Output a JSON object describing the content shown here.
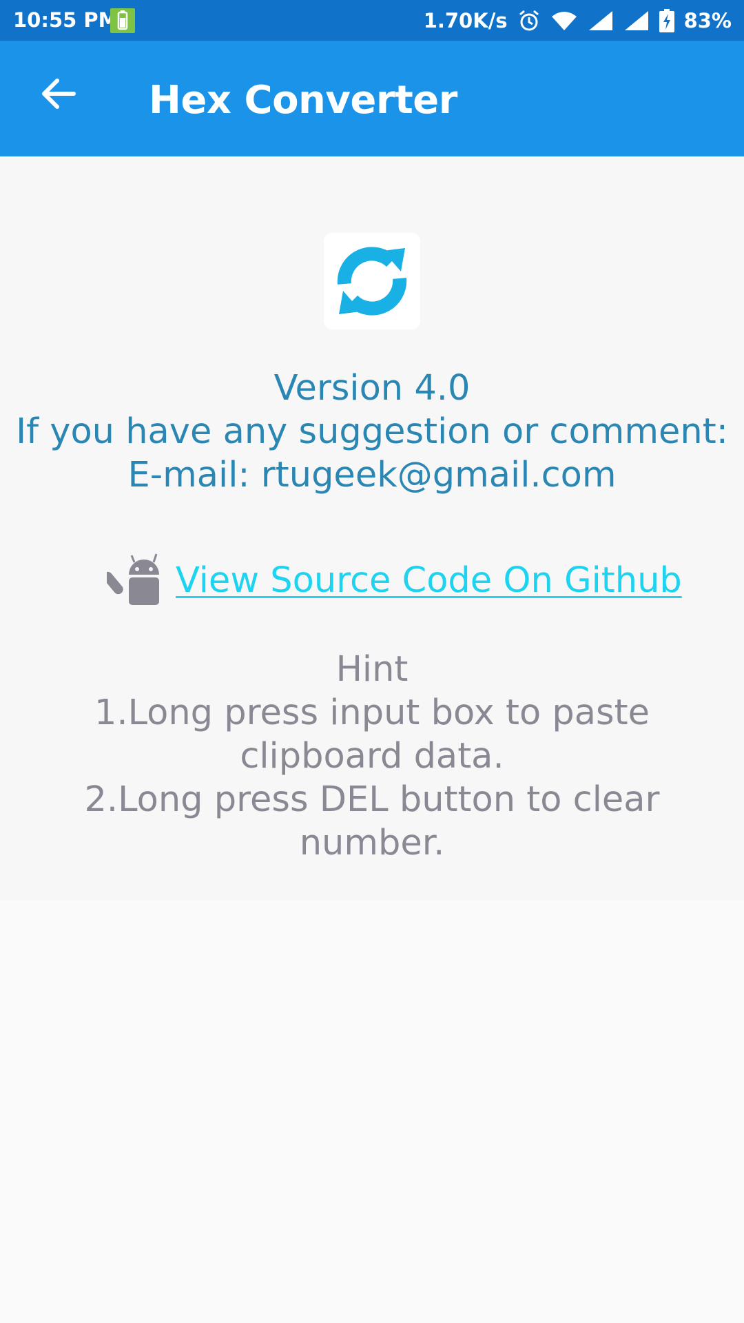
{
  "status_bar": {
    "time": "10:55 PM",
    "network_speed": "1.70K/s",
    "battery": "83%",
    "icons": [
      "battery-saver-icon",
      "alarm-icon",
      "wifi-icon",
      "signal-icon",
      "signal-icon",
      "battery-charging-icon"
    ]
  },
  "app_bar": {
    "title": "Hex Converter",
    "back_icon": "arrow-left-icon",
    "color": "#1a93e8"
  },
  "about": {
    "app_icon": "refresh-arrows-icon",
    "version": "Version 4.0",
    "suggestion": "If you have any suggestion or comment:",
    "email": "E-mail: rtugeek@gmail.com",
    "info_color": "#2a86b3"
  },
  "github": {
    "icon": "android-icon",
    "link_text": "View Source Code On Github",
    "link_color": "#1dd3f0"
  },
  "hint": {
    "title": "Hint",
    "line1": "1.Long press input box to paste",
    "line2": "clipboard data.",
    "line3": "2.Long press DEL button to clear",
    "line4": "number.",
    "color": "#8a8893"
  }
}
